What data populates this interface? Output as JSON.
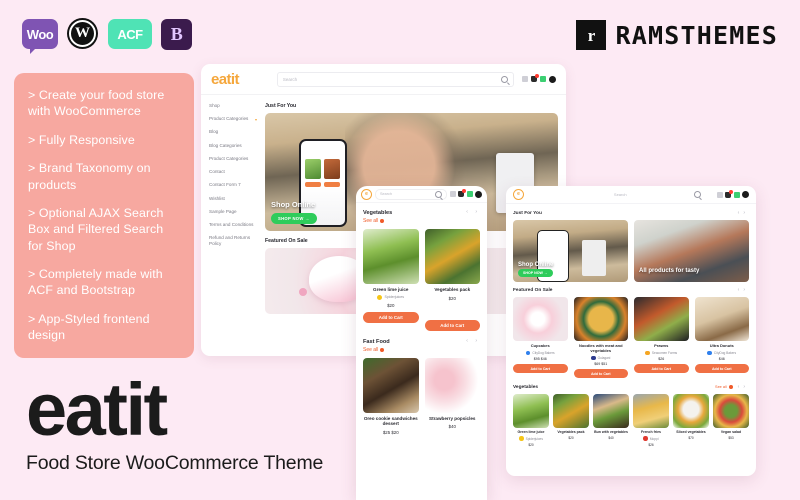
{
  "tech_logos": [
    {
      "name": "woocommerce-logo",
      "label": "Woo",
      "color": "#7f54b3"
    },
    {
      "name": "wordpress-logo",
      "label": "W",
      "color": "#111111"
    },
    {
      "name": "acf-logo",
      "label": "ACF",
      "color": "#4fe3b5"
    },
    {
      "name": "bootstrap-logo",
      "label": "B",
      "color": "#3b1b4d"
    }
  ],
  "vendor": {
    "mark": "r",
    "name": "RAMSTHEMES"
  },
  "features": [
    "> Create your food store with WooCommerce",
    "> Fully Responsive",
    "> Brand Taxonomy on products",
    "> Optional AJAX Search Box and Filtered Search for Shop",
    "> Completely made with ACF and  Bootstrap",
    "> App-Styled frontend design"
  ],
  "brand": {
    "name": "eatit",
    "tagline": "Food Store WooCommerce Theme",
    "accent": "#f5a73c"
  },
  "browser": {
    "logo": "eatit",
    "search_placeholder": "Search",
    "sidebar": [
      {
        "label": "Shop",
        "caret": ""
      },
      {
        "label": "Product Categories",
        "caret": "▾"
      },
      {
        "label": "Blog",
        "caret": ""
      },
      {
        "label": "Blog Categories",
        "caret": ""
      },
      {
        "label": "Product Categories",
        "caret": ""
      },
      {
        "label": "Contact",
        "caret": ""
      },
      {
        "label": "Contact Form 7",
        "caret": ""
      },
      {
        "label": "Wishlist",
        "caret": ""
      },
      {
        "label": "Sample Page",
        "caret": ""
      },
      {
        "label": "Terms and Conditions",
        "caret": ""
      },
      {
        "label": "Refund and Returns Policy",
        "caret": ""
      }
    ],
    "just_for_you": "Just For You",
    "hero_caption": "Shop Online",
    "hero_button": "SHOP NOW →",
    "featured_title": "Featured On Sale"
  },
  "phone": {
    "search_placeholder": "Search",
    "cart_badge": "1",
    "sections": [
      {
        "title": "Vegetables",
        "see_all": "See all",
        "products": [
          {
            "name": "Green lime juice",
            "brand": "Spiderjuices",
            "price": "$20"
          },
          {
            "name": "Vegetables pack",
            "brand": "",
            "price": "$20"
          }
        ],
        "cart_label": "Add to Cart"
      },
      {
        "title": "Fast Food",
        "see_all": "See all",
        "products": [
          {
            "name": "Oreo cookie sandwiches dessert",
            "brand": "",
            "price": "$25 $20"
          },
          {
            "name": "Strawberry popsicles",
            "brand": "",
            "price": "$40"
          }
        ],
        "cart_label": "Add to Cart"
      }
    ]
  },
  "tablet": {
    "search_placeholder": "Search",
    "just_for_you": "Just For You",
    "hero_left_caption": "Shop Online",
    "hero_left_button": "SHOP NOW →",
    "hero_right_caption": "All products for tasty",
    "featured_title": "Featured On Sale",
    "featured": [
      {
        "name": "Cupcakes",
        "brand": "CityDog Bakers",
        "brand_color": "#2f80ed",
        "price": "$95 $46",
        "cart": "Add to Cart",
        "img": "i-cup"
      },
      {
        "name": "Noodles with meat and vegetables",
        "brand": "Gulagani",
        "brand_color": "#2d3b8f",
        "price": "$69 $51",
        "cart": "Add to Cart",
        "img": "i-noodle"
      },
      {
        "name": "Prawns",
        "brand": "Seacomen Farms",
        "brand_color": "#f5a623",
        "price": "$26",
        "cart": "Add to Cart",
        "img": "i-prawn"
      },
      {
        "name": "Ultra Donuts",
        "brand": "CityDog Bakers",
        "brand_color": "#2f80ed",
        "price": "$46",
        "cart": "Add to Cart",
        "img": "i-donut"
      }
    ],
    "veg_title": "Vegetables",
    "veg_see_all": "See all",
    "vegetables": [
      {
        "name": "Green lime juice",
        "brand": "Spiderjuices",
        "price": "$20",
        "img": "i-lime"
      },
      {
        "name": "Vegetables pack",
        "brand": "",
        "price": "$20",
        "img": "i-vegpack"
      },
      {
        "name": "Bun with vegetables",
        "brand": "",
        "price": "$40",
        "img": "i-bun"
      },
      {
        "name": "French fries",
        "brand": "Moppi",
        "price": "$26",
        "img": "i-fries"
      },
      {
        "name": "Sliced vegetables",
        "brand": "",
        "price": "$70",
        "img": "i-sliced"
      },
      {
        "name": "Vegan salad",
        "brand": "",
        "price": "$53",
        "img": "i-salad"
      }
    ]
  }
}
